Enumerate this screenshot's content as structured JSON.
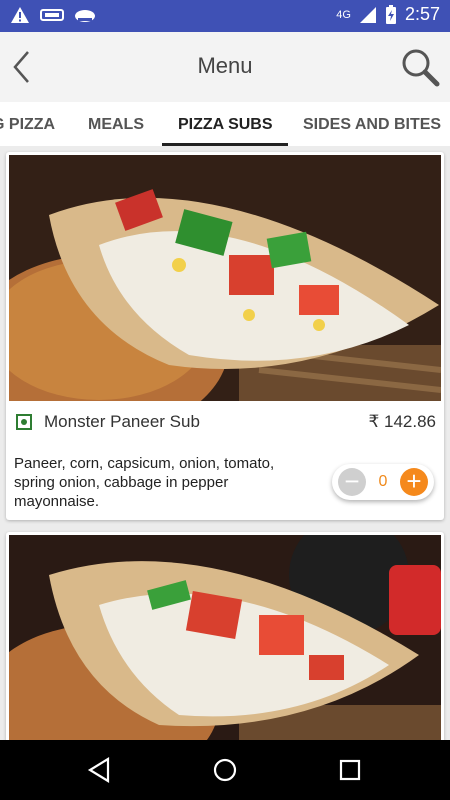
{
  "status_bar": {
    "time": "2:57",
    "network": "4G",
    "icons": [
      "warning-icon",
      "brand-logo-icon",
      "cloud-icon"
    ],
    "battery": "battery-charging-icon"
  },
  "app_bar": {
    "title": "Menu",
    "back_icon": "chevron-left-icon",
    "search_icon": "search-icon"
  },
  "tabs": [
    {
      "label": "G PIZZA",
      "active": false
    },
    {
      "label": "MEALS",
      "active": false
    },
    {
      "label": "PIZZA SUBS",
      "active": true
    },
    {
      "label": "SIDES AND BITES",
      "active": false
    }
  ],
  "items": [
    {
      "name": "Monster Paneer Sub",
      "price": "₹ 142.86",
      "description": "Paneer, corn, capsicum, onion, tomato, spring onion, cabbage in pepper mayonnaise.",
      "quantity": "0",
      "veg": true
    }
  ],
  "stepper": {
    "minus_label": "−",
    "plus_label": "+"
  },
  "colors": {
    "status_bar": "#3f51b5",
    "accent": "#f5891c",
    "veg": "#2e7d32"
  }
}
